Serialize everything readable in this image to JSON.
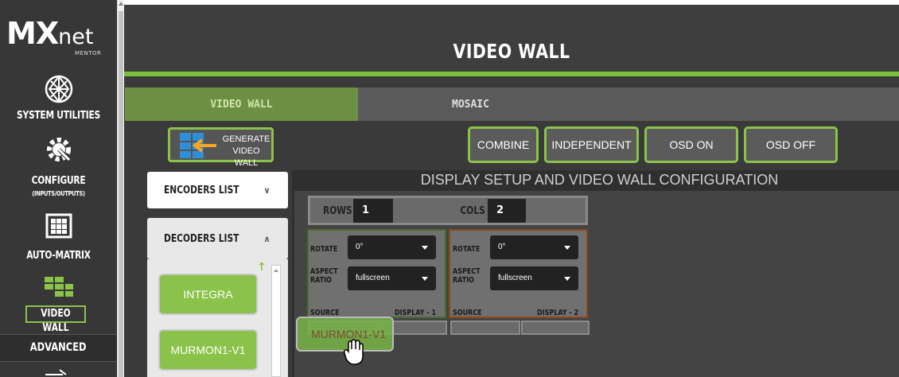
{
  "brand": {
    "mx": "MX",
    "net": "net",
    "mentor": "MENTOR"
  },
  "sidebar": {
    "items": [
      {
        "label": "SYSTEM UTILITIES",
        "icon": "network-globe-icon"
      },
      {
        "label": "CONFIGURE",
        "sub": "(INPUTS/OUTPUTS)",
        "icon": "gear-icon"
      },
      {
        "label": "AUTO-MATRIX",
        "icon": "grid-icon"
      },
      {
        "label": "VIDEO WALL",
        "icon": "videowall-icon"
      },
      {
        "label": "ADVANCED",
        "icon": "arrow-icon"
      }
    ]
  },
  "header": {
    "title": "VIDEO WALL"
  },
  "tabs": [
    {
      "label": "VIDEO WALL"
    },
    {
      "label": "MOSAIC"
    }
  ],
  "toolbar": {
    "generate_line1": "GENERATE",
    "generate_line2": "VIDEO WALL",
    "combine": "COMBINE",
    "independent": "INDEPENDENT",
    "osd_on": "OSD ON",
    "osd_off": "OSD OFF"
  },
  "lists": {
    "encoders": "ENCODERS LIST",
    "decoders": "DECODERS LIST",
    "decoder_items": [
      "INTEGRA",
      "MURMON1-V1"
    ]
  },
  "config": {
    "title": "DISPLAY SETUP AND VIDEO WALL CONFIGURATION",
    "rows_label": "ROWS",
    "rows": "1",
    "cols_label": "COLS",
    "cols": "2",
    "displays": [
      {
        "rotate_label": "ROTATE",
        "rotate": "0°",
        "aspect_label_1": "ASPECT",
        "aspect_label_2": "RATIO",
        "aspect": "fullscreen",
        "source_label": "SOURCE",
        "name": "DISPLAY - 1"
      },
      {
        "rotate_label": "ROTATE",
        "rotate": "0°",
        "aspect_label_1": "ASPECT",
        "aspect_label_2": "RATIO",
        "aspect": "fullscreen",
        "source_label": "SOURCE",
        "name": "DISPLAY - 2"
      }
    ]
  },
  "drag": {
    "label": "MURMON1-V1"
  },
  "colors": {
    "accent": "#8bc34a",
    "header_bg": "#3e3e3e",
    "sidebar_bg": "#373737"
  }
}
